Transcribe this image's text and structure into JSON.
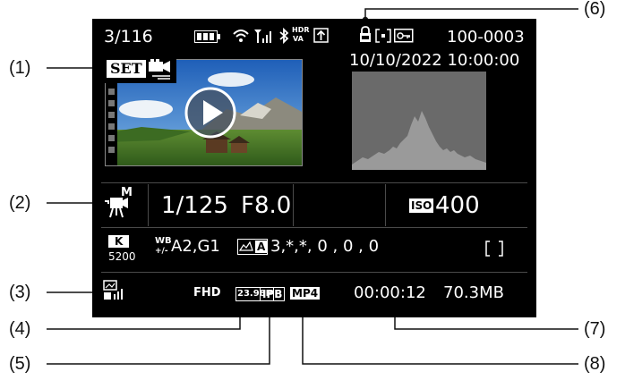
{
  "screen": {
    "frame_counter": "3/116",
    "folder_file": "100-0003",
    "date_time": "10/10/2022 10:00:00",
    "set_label": "SET",
    "shutter_speed": "1/125",
    "aperture": "F8.0",
    "iso_label": "ISO",
    "iso_value": "400",
    "wb_mode": "K",
    "wb_kelvin": "5200",
    "wb_label": "WB",
    "wb_shift_label": "+/-",
    "wb_shift": "A2,G1",
    "picture_style_badge": "A",
    "picture_style_params": "3,*,*, 0 , 0 , 0",
    "hdr_top": "HDR",
    "hdr_bottom": "VA",
    "movie_mode_letter": "M",
    "resolution": "FHD",
    "frame_rate": "23.98P",
    "compression": "IPB",
    "format": "MP4",
    "duration": "00:00:12",
    "file_size": "70.3MB"
  },
  "callouts": {
    "c1": "(1)",
    "c2": "(2)",
    "c3": "(3)",
    "c4": "(4)",
    "c5": "(5)",
    "c6": "(6)",
    "c7": "(7)",
    "c8": "(8)"
  },
  "colors": {
    "screen_bg": "#000000",
    "text": "#ffffff",
    "divider": "#4a4a4a",
    "histogram": "#8c8c8c",
    "histogram_bg": "#6a6a6a"
  }
}
